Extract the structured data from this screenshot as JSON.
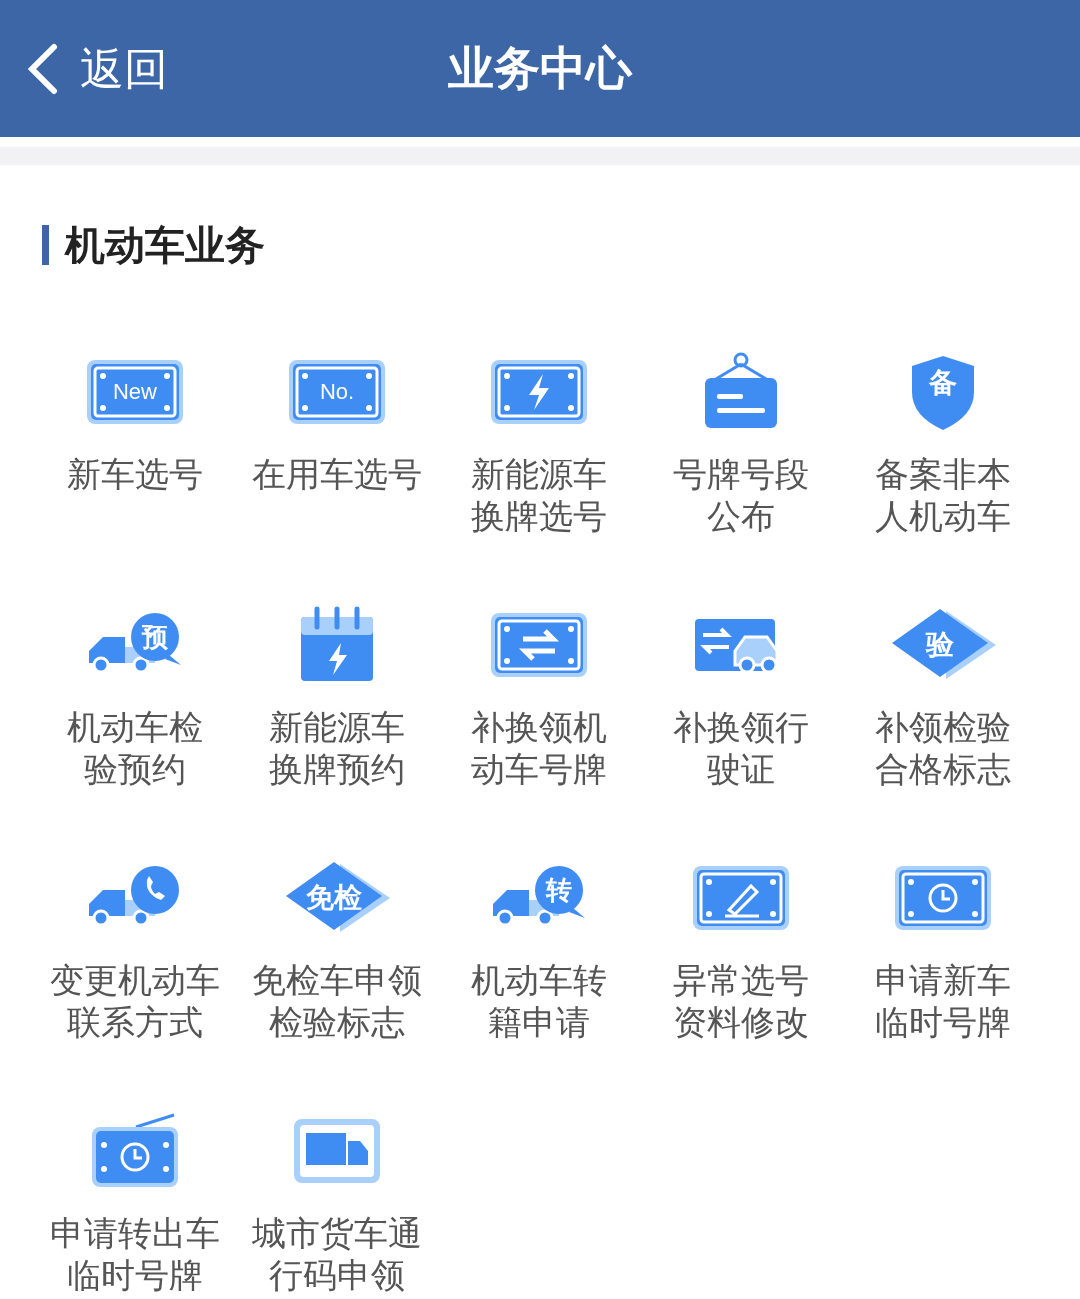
{
  "header": {
    "back": "返回",
    "title": "业务中心"
  },
  "section": {
    "title": "机动车业务",
    "items": [
      {
        "kind": "plate",
        "badge": "New",
        "label": [
          "新车选号"
        ]
      },
      {
        "kind": "plate",
        "badge": "No.",
        "label": [
          "在用车选号"
        ]
      },
      {
        "kind": "plate-bolt",
        "label": [
          "新能源车",
          "换牌选号"
        ]
      },
      {
        "kind": "sign",
        "label": [
          "号牌号段",
          "公布"
        ]
      },
      {
        "kind": "shield",
        "badge": "备",
        "label": [
          "备案非本",
          "人机动车"
        ]
      },
      {
        "kind": "truck-bubble",
        "badge": "预",
        "label": [
          "机动车检",
          "验预约"
        ]
      },
      {
        "kind": "calendar",
        "label": [
          "新能源车",
          "换牌预约"
        ]
      },
      {
        "kind": "plate-swap",
        "label": [
          "补换领机",
          "动车号牌"
        ]
      },
      {
        "kind": "car-swap",
        "label": [
          "补换领行",
          "驶证"
        ]
      },
      {
        "kind": "diamond",
        "badge": "验",
        "label": [
          "补领检验",
          "合格标志"
        ]
      },
      {
        "kind": "truck-phone",
        "label": [
          "变更机动车",
          "联系方式"
        ]
      },
      {
        "kind": "diamond",
        "badge": "免检",
        "label": [
          "免检车申领",
          "检验标志"
        ]
      },
      {
        "kind": "truck-bubble",
        "badge": "转",
        "label": [
          "机动车转",
          "籍申请"
        ]
      },
      {
        "kind": "plate-pencil",
        "label": [
          "异常选号",
          "资料修改"
        ]
      },
      {
        "kind": "plate-clock",
        "label": [
          "申请新车",
          "临时号牌"
        ]
      },
      {
        "kind": "radio",
        "label": [
          "申请转出车",
          "临时号牌"
        ]
      },
      {
        "kind": "van",
        "label": [
          "城市货车通",
          "行码申领"
        ]
      }
    ]
  }
}
